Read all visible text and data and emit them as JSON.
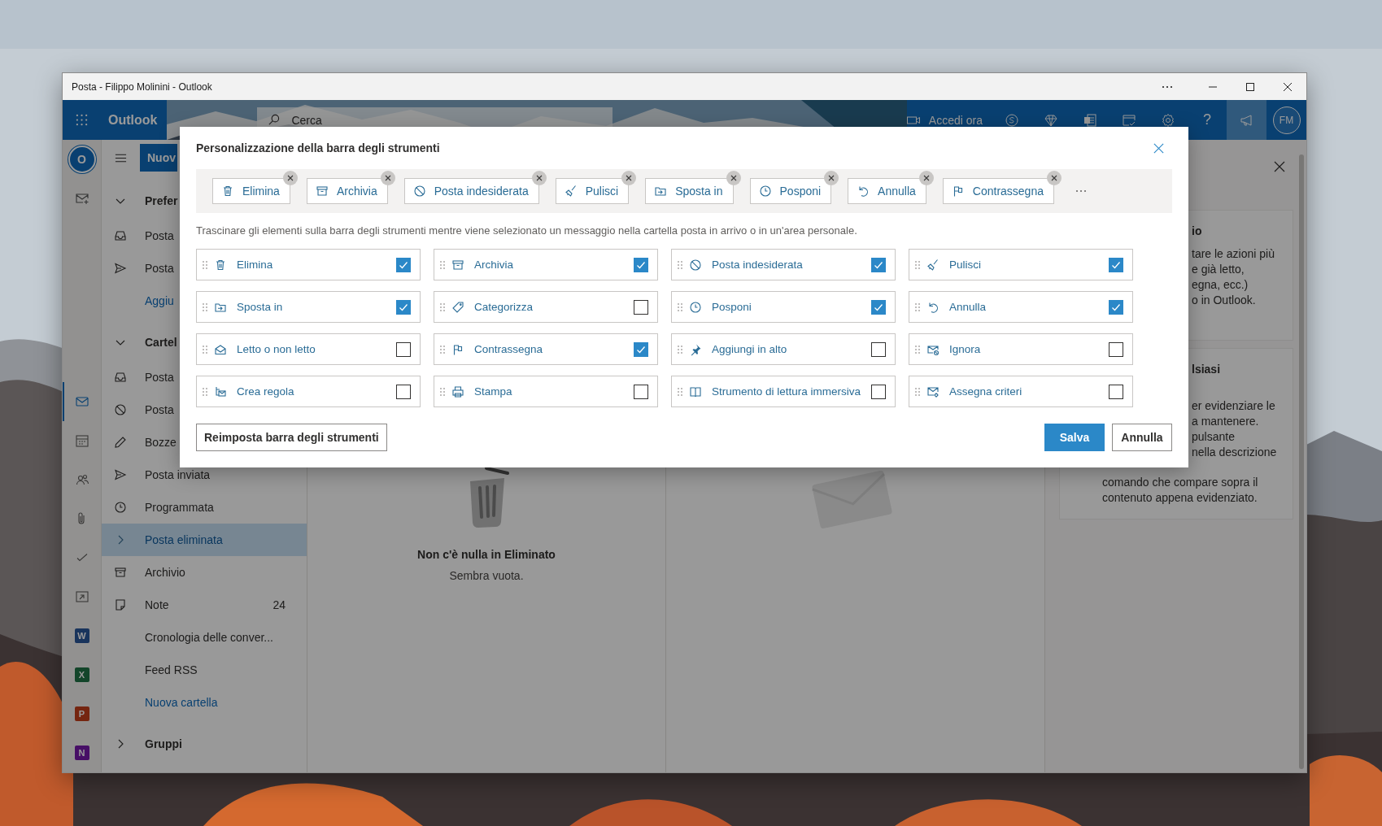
{
  "window": {
    "title": "Posta - Filippo Molinini - Outlook"
  },
  "header": {
    "app_name": "Outlook",
    "search": {
      "placeholder": "Cerca"
    },
    "meet_now": "Accedi ora",
    "help": "?",
    "avatar": "FM"
  },
  "rail": {
    "logo": "O",
    "items": [
      {
        "kind": "mail",
        "selected": true
      },
      {
        "kind": "calendar",
        "selected": false
      },
      {
        "kind": "people",
        "selected": false
      },
      {
        "kind": "files",
        "selected": false
      },
      {
        "kind": "todo",
        "selected": false
      },
      {
        "kind": "apps",
        "selected": false
      },
      {
        "kind": "word",
        "letter": "W",
        "selected": false
      },
      {
        "kind": "excel",
        "letter": "X",
        "selected": false
      },
      {
        "kind": "powerpoint",
        "letter": "P",
        "selected": false
      },
      {
        "kind": "onenote",
        "letter": "N",
        "selected": false
      }
    ]
  },
  "folder_pane": {
    "new_button": "Nuov",
    "folders": [
      {
        "kind": "section",
        "label": "Prefer",
        "expanded": true,
        "selected": false
      },
      {
        "kind": "inbox",
        "label": "Posta",
        "selected": false
      },
      {
        "kind": "sent",
        "label": "Posta",
        "selected": false
      },
      {
        "kind": "link",
        "label": "Aggiu",
        "selected": false
      },
      {
        "kind": "section",
        "label": "Cartel",
        "expanded": true,
        "selected": false
      },
      {
        "kind": "inbox",
        "label": "Posta",
        "selected": false
      },
      {
        "kind": "junk",
        "label": "Posta",
        "selected": false
      },
      {
        "kind": "drafts",
        "label": "Bozze",
        "selected": false
      },
      {
        "kind": "sent",
        "label": "Posta inviata",
        "selected": false
      },
      {
        "kind": "scheduled",
        "label": "Programmata",
        "selected": false
      },
      {
        "kind": "folder",
        "label": "Posta eliminata",
        "expanded": false,
        "selected": true
      },
      {
        "kind": "archive",
        "label": "Archivio",
        "selected": false
      },
      {
        "kind": "notes",
        "label": "Note",
        "count": "24",
        "selected": false
      },
      {
        "kind": "plain",
        "label": "Cronologia delle conver...",
        "selected": false
      },
      {
        "kind": "plain",
        "label": "Feed RSS",
        "selected": false
      },
      {
        "kind": "link",
        "label": "Nuova cartella",
        "selected": false
      },
      {
        "kind": "section",
        "label": "Gruppi",
        "expanded": false,
        "selected": false
      }
    ]
  },
  "message_list": {
    "empty_title": "Non c'è nulla in Eliminato",
    "empty_subtitle": "Sembra vuota."
  },
  "side_panel": {
    "cards": [
      {
        "heading": {
          "text": "io",
          "clipped": true
        },
        "lines": [
          {
            "text": "tare le azioni più",
            "clipped": true
          },
          {
            "text": "e già letto,",
            "clipped": true
          },
          {
            "text": "egna, ecc.)",
            "clipped": true
          },
          {
            "text": "o in Outlook.",
            "clipped": true
          }
        ]
      },
      {
        "heading": {
          "text": "lsiasi",
          "clipped": true
        },
        "lines": [
          {
            "text": "er evidenziare le",
            "clipped": true
          },
          {
            "text": "a mantenere.",
            "clipped": true
          },
          {
            "text": "pulsante",
            "clipped": true
          },
          {
            "text": "nella descrizione",
            "clipped": true
          },
          {
            "text": "comando che compare sopra il",
            "clipped": false
          },
          {
            "text": "contenuto appena evidenziato.",
            "clipped": false
          }
        ]
      }
    ]
  },
  "dialog": {
    "title": "Personalizzazione della barra degli strumenti",
    "toolbar": [
      {
        "kind": "delete",
        "label": "Elimina"
      },
      {
        "kind": "archive",
        "label": "Archivia"
      },
      {
        "kind": "junk",
        "label": "Posta indesiderata"
      },
      {
        "kind": "sweep",
        "label": "Pulisci"
      },
      {
        "kind": "move",
        "label": "Sposta in"
      },
      {
        "kind": "snooze",
        "label": "Posponi"
      },
      {
        "kind": "undo",
        "label": "Annulla"
      },
      {
        "kind": "flag",
        "label": "Contrassegna"
      }
    ],
    "description": "Trascinare gli elementi sulla barra degli strumenti mentre viene selezionato un messaggio nella cartella posta in arrivo o in un'area personale.",
    "options": [
      {
        "kind": "delete",
        "label": "Elimina",
        "checked": true
      },
      {
        "kind": "archive",
        "label": "Archivia",
        "checked": true
      },
      {
        "kind": "junk",
        "label": "Posta indesiderata",
        "checked": true
      },
      {
        "kind": "sweep",
        "label": "Pulisci",
        "checked": true
      },
      {
        "kind": "move",
        "label": "Sposta in",
        "checked": true
      },
      {
        "kind": "categorize",
        "label": "Categorizza",
        "checked": false
      },
      {
        "kind": "snooze",
        "label": "Posponi",
        "checked": true
      },
      {
        "kind": "undo",
        "label": "Annulla",
        "checked": true
      },
      {
        "kind": "read",
        "label": "Letto o non letto",
        "checked": false
      },
      {
        "kind": "flag",
        "label": "Contrassegna",
        "checked": true
      },
      {
        "kind": "pin",
        "label": "Aggiungi in alto",
        "checked": false
      },
      {
        "kind": "ignore",
        "label": "Ignora",
        "checked": false
      },
      {
        "kind": "rule",
        "label": "Crea regola",
        "checked": false
      },
      {
        "kind": "print",
        "label": "Stampa",
        "checked": false
      },
      {
        "kind": "reader",
        "label": "Strumento di lettura immersiva",
        "checked": false
      },
      {
        "kind": "policy",
        "label": "Assegna criteri",
        "checked": false
      }
    ],
    "reset_button": "Reimposta barra degli strumenti",
    "save_button": "Salva",
    "cancel_button": "Annulla"
  }
}
